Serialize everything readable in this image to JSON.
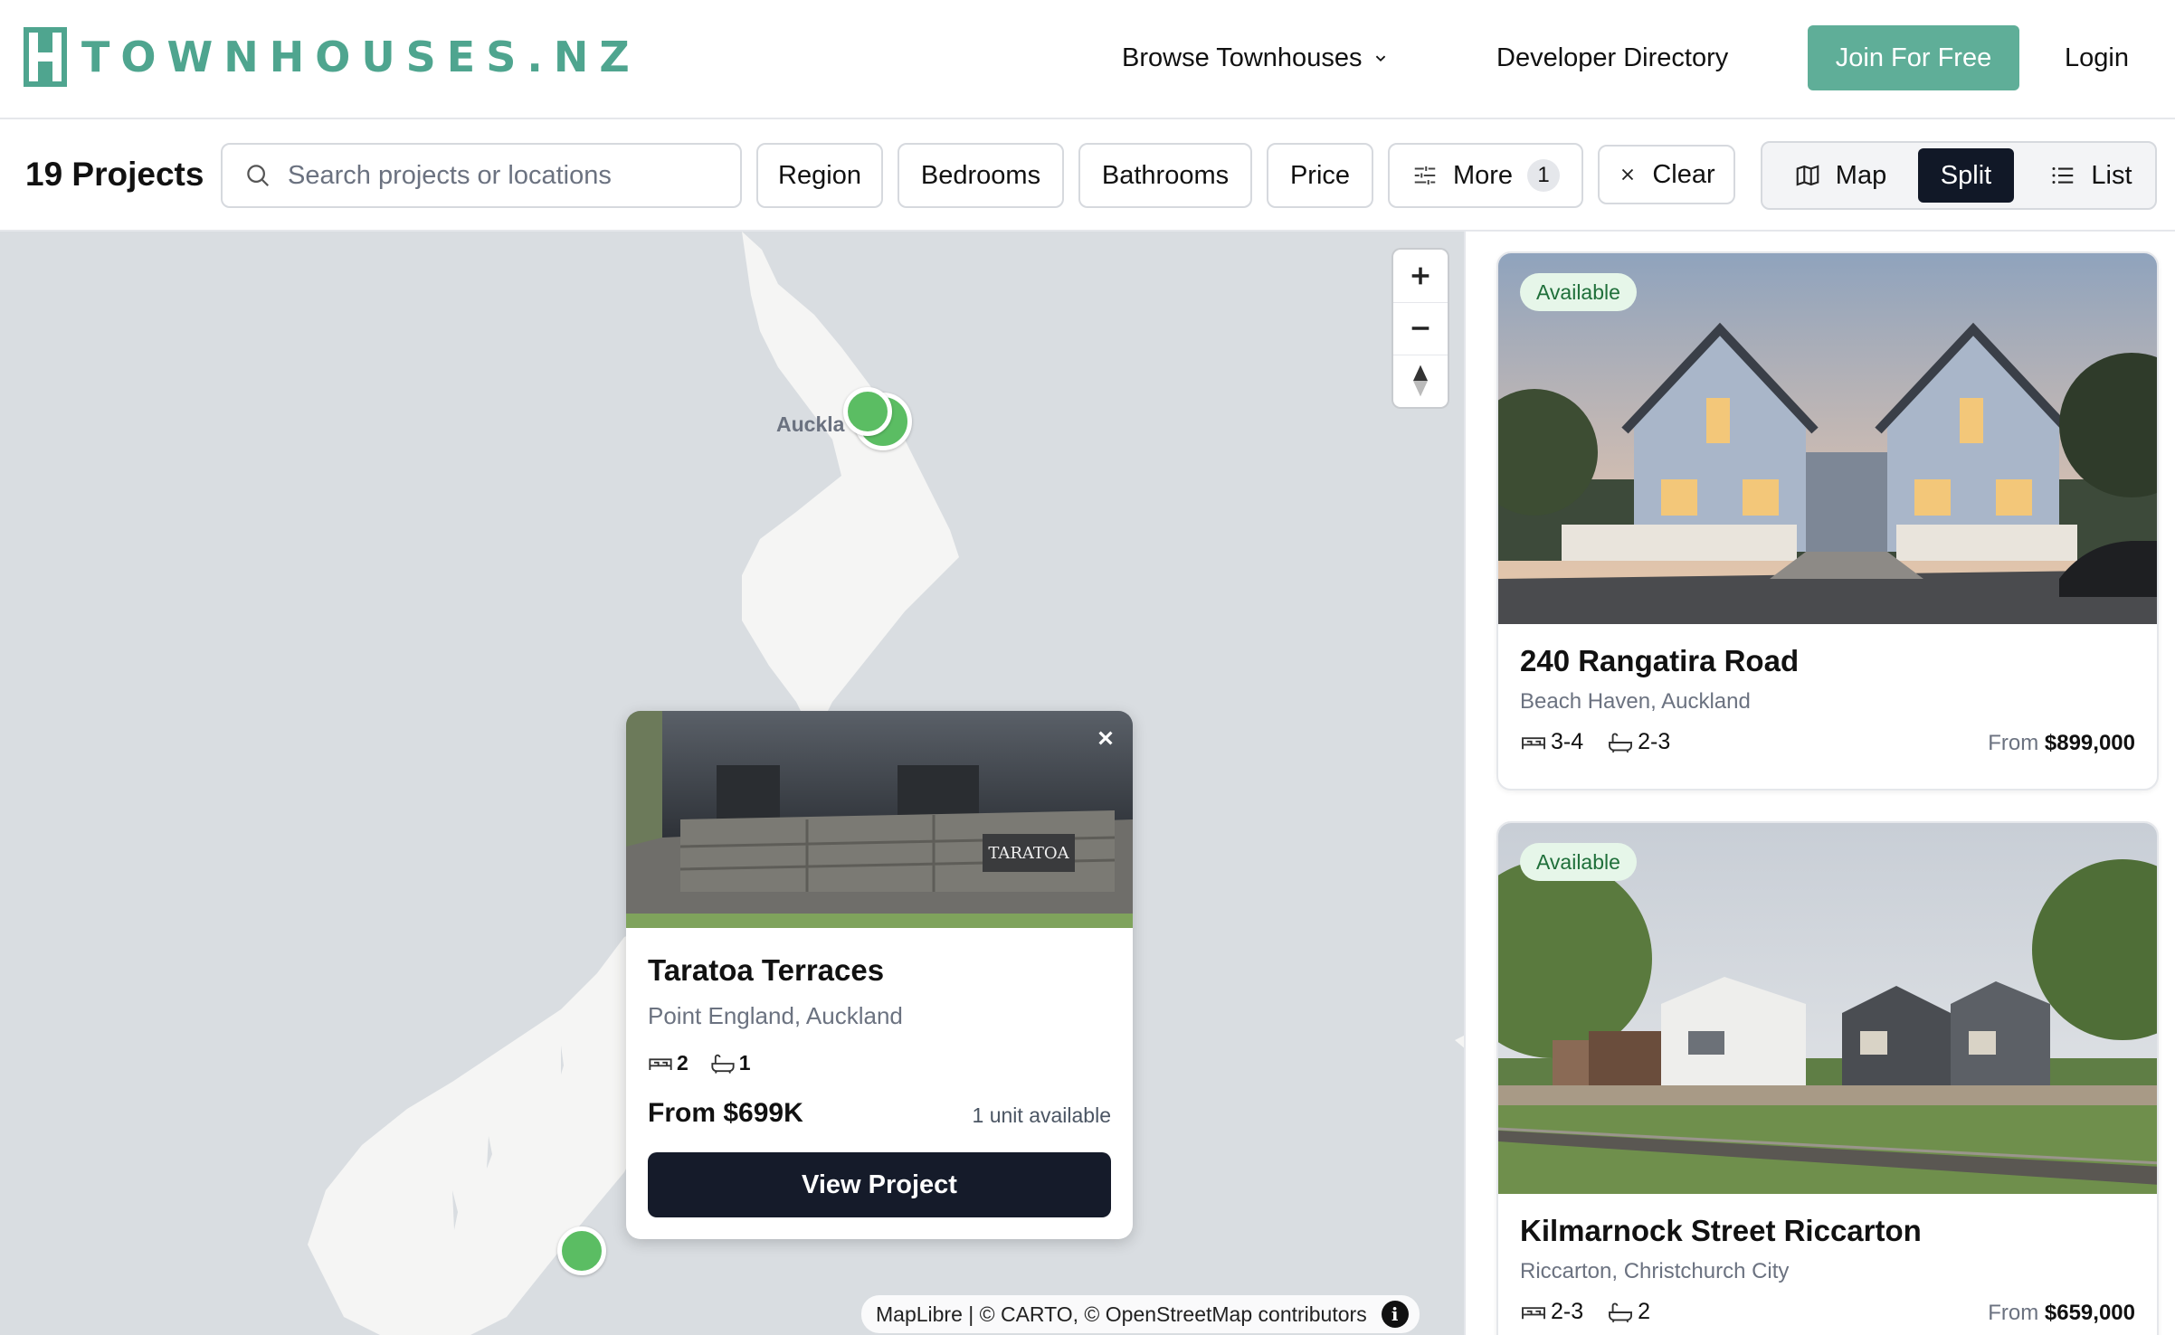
{
  "header": {
    "logo_text": "TOWNHOUSES.NZ",
    "nav": {
      "browse": "Browse Townhouses",
      "developer_directory": "Developer Directory",
      "join": "Join For Free",
      "login": "Login"
    }
  },
  "filters": {
    "count_label": "19 Projects",
    "search_placeholder": "Search projects or locations",
    "region": "Region",
    "bedrooms": "Bedrooms",
    "bathrooms": "Bathrooms",
    "price": "Price",
    "more": "More",
    "more_count": "1",
    "clear": "Clear",
    "views": {
      "map": "Map",
      "split": "Split",
      "list": "List",
      "active": "Split"
    }
  },
  "map": {
    "city_label": "Auckla",
    "attribution": "MapLibre | © CARTO, © OpenStreetMap contributors",
    "popup": {
      "title": "Taratoa Terraces",
      "location": "Point England, Auckland",
      "bedrooms": "2",
      "bathrooms": "1",
      "price": "From $699K",
      "availability": "1 unit available",
      "button": "View Project",
      "sign_text": "TARATOA"
    }
  },
  "listings": [
    {
      "status": "Available",
      "title": "240 Rangatira Road",
      "location": "Beach Haven, Auckland",
      "bedrooms": "3-4",
      "bathrooms": "2-3",
      "price_prefix": "From",
      "price": "$899,000"
    },
    {
      "status": "Available",
      "title": "Kilmarnock Street Riccarton",
      "location": "Riccarton, Christchurch City",
      "bedrooms": "2-3",
      "bathrooms": "2",
      "price_prefix": "From",
      "price": "$659,000"
    }
  ],
  "colors": {
    "brand": "#4fa58f",
    "join_button": "#5fae98",
    "marker": "#5bbd63",
    "dark_button": "#151b2a",
    "map_water": "#d9dde1"
  }
}
